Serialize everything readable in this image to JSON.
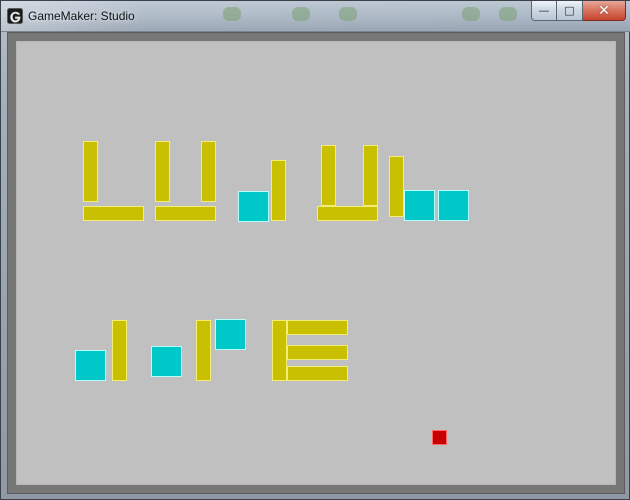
{
  "window": {
    "title": "GameMaker: Studio"
  },
  "icons": {
    "app": "gamemaker-icon",
    "minimize": "minimize-icon",
    "maximize": "maximize-icon",
    "close": "close-icon"
  },
  "caption_glyphs": {
    "minimize": "—",
    "maximize": "□",
    "close": "✕"
  },
  "colors": {
    "room_background": "#c0c0c0",
    "wall_yellow": "#c8c000",
    "wall_yellow_outline": "#f3ee73",
    "block_cyan": "#00c8c8",
    "block_cyan_outline": "#b7ffff",
    "player_red": "#c80000",
    "player_red_outline": "#ff6b6b"
  }
}
